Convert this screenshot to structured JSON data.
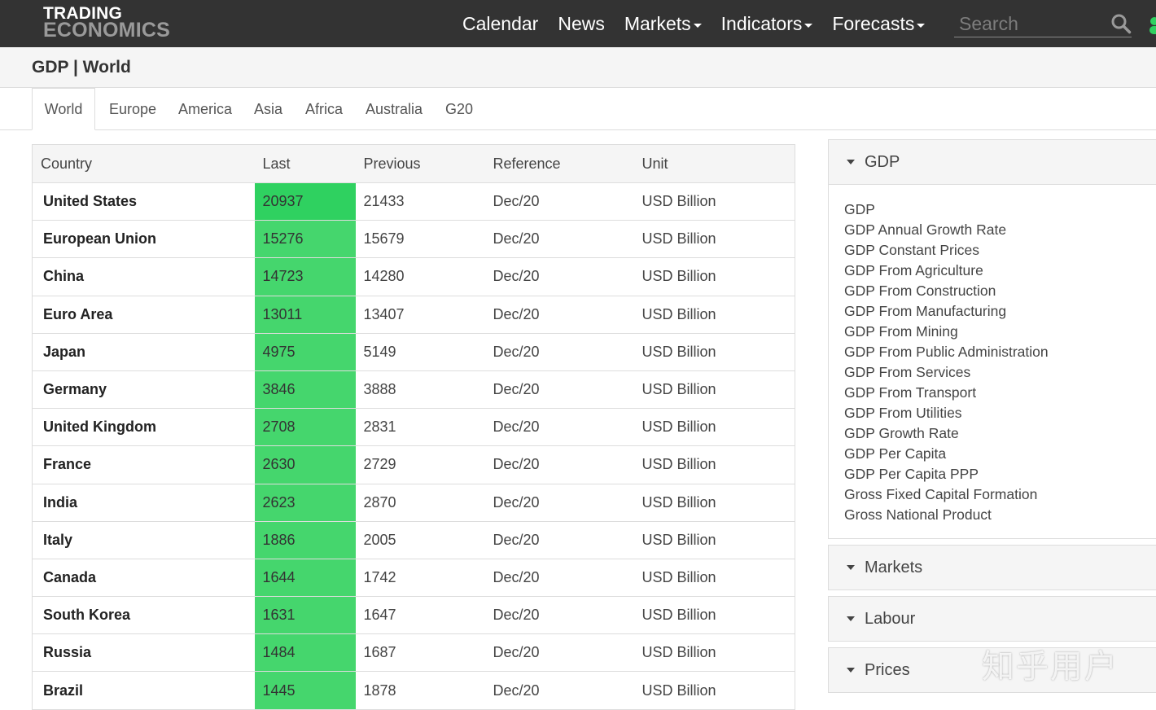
{
  "logo": {
    "line1": "TRADING",
    "line2": "ECONOMICS"
  },
  "nav": [
    {
      "label": "Calendar",
      "dropdown": false
    },
    {
      "label": "News",
      "dropdown": false
    },
    {
      "label": "Markets",
      "dropdown": true
    },
    {
      "label": "Indicators",
      "dropdown": true
    },
    {
      "label": "Forecasts",
      "dropdown": true
    }
  ],
  "search": {
    "placeholder": "Search",
    "value": ""
  },
  "page": {
    "title": "GDP | World"
  },
  "tabs": [
    {
      "label": "World",
      "active": true
    },
    {
      "label": "Europe"
    },
    {
      "label": "America"
    },
    {
      "label": "Asia"
    },
    {
      "label": "Africa"
    },
    {
      "label": "Australia"
    },
    {
      "label": "G20"
    }
  ],
  "table": {
    "headers": [
      "Country",
      "Last",
      "Previous",
      "Reference",
      "Unit"
    ],
    "rows": [
      {
        "country": "United States",
        "last": "20937",
        "previous": "21433",
        "reference": "Dec/20",
        "unit": "USD Billion"
      },
      {
        "country": "European Union",
        "last": "15276",
        "previous": "15679",
        "reference": "Dec/20",
        "unit": "USD Billion"
      },
      {
        "country": "China",
        "last": "14723",
        "previous": "14280",
        "reference": "Dec/20",
        "unit": "USD Billion"
      },
      {
        "country": "Euro Area",
        "last": "13011",
        "previous": "13407",
        "reference": "Dec/20",
        "unit": "USD Billion"
      },
      {
        "country": "Japan",
        "last": "4975",
        "previous": "5149",
        "reference": "Dec/20",
        "unit": "USD Billion"
      },
      {
        "country": "Germany",
        "last": "3846",
        "previous": "3888",
        "reference": "Dec/20",
        "unit": "USD Billion"
      },
      {
        "country": "United Kingdom",
        "last": "2708",
        "previous": "2831",
        "reference": "Dec/20",
        "unit": "USD Billion"
      },
      {
        "country": "France",
        "last": "2630",
        "previous": "2729",
        "reference": "Dec/20",
        "unit": "USD Billion"
      },
      {
        "country": "India",
        "last": "2623",
        "previous": "2870",
        "reference": "Dec/20",
        "unit": "USD Billion"
      },
      {
        "country": "Italy",
        "last": "1886",
        "previous": "2005",
        "reference": "Dec/20",
        "unit": "USD Billion"
      },
      {
        "country": "Canada",
        "last": "1644",
        "previous": "1742",
        "reference": "Dec/20",
        "unit": "USD Billion"
      },
      {
        "country": "South Korea",
        "last": "1631",
        "previous": "1647",
        "reference": "Dec/20",
        "unit": "USD Billion"
      },
      {
        "country": "Russia",
        "last": "1484",
        "previous": "1687",
        "reference": "Dec/20",
        "unit": "USD Billion"
      },
      {
        "country": "Brazil",
        "last": "1445",
        "previous": "1878",
        "reference": "Dec/20",
        "unit": "USD Billion"
      }
    ]
  },
  "sidebar": {
    "gdp_panel": {
      "title": "GDP",
      "links": [
        "GDP",
        "GDP Annual Growth Rate",
        "GDP Constant Prices",
        "GDP From Agriculture",
        "GDP From Construction",
        "GDP From Manufacturing",
        "GDP From Mining",
        "GDP From Public Administration",
        "GDP From Services",
        "GDP From Transport",
        "GDP From Utilities",
        "GDP Growth Rate",
        "GDP Per Capita",
        "GDP Per Capita PPP",
        "Gross Fixed Capital Formation",
        "Gross National Product"
      ]
    },
    "collapsed_panels": [
      "Markets",
      "Labour",
      "Prices"
    ]
  },
  "watermark": "知乎用户",
  "colors": {
    "navbar": "#333333",
    "last_cell": "#45d66d",
    "last_cell_first": "#2fd160"
  }
}
